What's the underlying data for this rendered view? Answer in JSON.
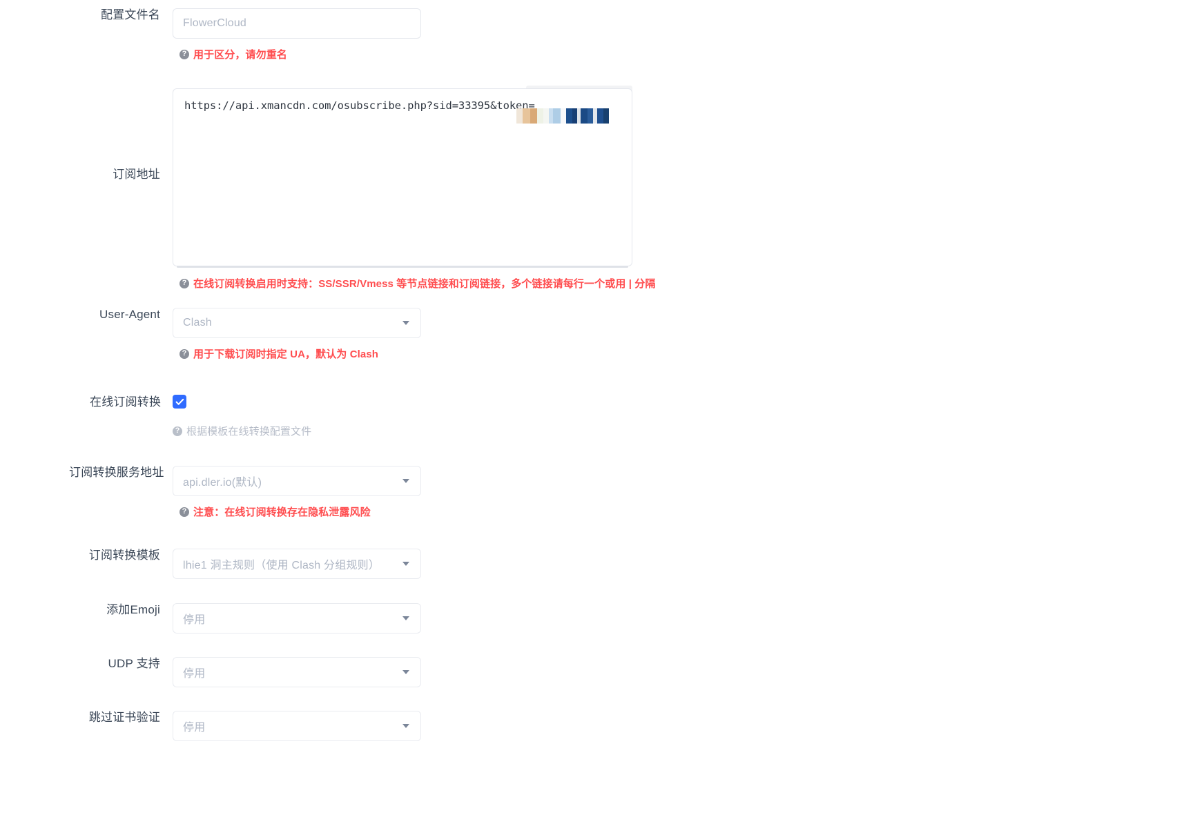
{
  "form": {
    "profile_name": {
      "label": "配置文件名",
      "value": "FlowerCloud",
      "hint": "用于区分，请勿重名",
      "hint_icon": "question-circle-icon"
    },
    "subscribe_url": {
      "label": "订阅地址",
      "value": "https://api.xmancdn.com/osubscribe.php?sid=33395&token=",
      "redacted": true,
      "hint": "在线订阅转换启用时支持：SS/SSR/Vmess 等节点链接和订阅链接，多个链接请每行一个或用 | 分隔",
      "hint_icon": "question-circle-icon",
      "mosaic_colors": [
        "#f0e6d9",
        "#e7c49b",
        "#d9a976",
        "#eef2e6",
        "#f4f6f2",
        "#c9def0",
        "#aecde6",
        "#f7f8fa",
        "#1c4e8c",
        "#173f74",
        "#dfe4ea",
        "#1b4a85",
        "#2a5c9a",
        "#e3e7ec",
        "#1f4f8f",
        "#18406f"
      ]
    },
    "user_agent": {
      "label": "User-Agent",
      "value": "Clash",
      "hint": "用于下载订阅时指定 UA，默认为 Clash",
      "hint_icon": "question-circle-icon",
      "caret_icon": "chevron-down-icon"
    },
    "online_convert": {
      "label": "在线订阅转换",
      "checked": true,
      "check_icon": "checkmark-icon",
      "hint": "根据模板在线转换配置文件",
      "hint_icon": "question-circle-icon"
    },
    "convert_service": {
      "label": "订阅转换服务地址",
      "value": "api.dler.io(默认)",
      "hint": "注意：在线订阅转换存在隐私泄露风险",
      "hint_icon": "question-circle-icon",
      "caret_icon": "chevron-down-icon"
    },
    "convert_template": {
      "label": "订阅转换模板",
      "value": "lhie1 洞主规则（使用 Clash 分组规则）",
      "caret_icon": "chevron-down-icon"
    },
    "add_emoji": {
      "label": "添加Emoji",
      "value": "停用",
      "caret_icon": "chevron-down-icon"
    },
    "udp_support": {
      "label": "UDP 支持",
      "value": "停用",
      "caret_icon": "chevron-down-icon"
    },
    "skip_cert_verify": {
      "label": "跳过证书验证",
      "value": "停用",
      "caret_icon": "chevron-down-icon"
    }
  },
  "colors": {
    "accent": "#2f6bff",
    "hint_red": "#ff4d4f",
    "hint_gray": "#b6bcc8",
    "label": "#3c4858",
    "placeholder": "#aeb6c4",
    "border": "#e4e7ed"
  }
}
